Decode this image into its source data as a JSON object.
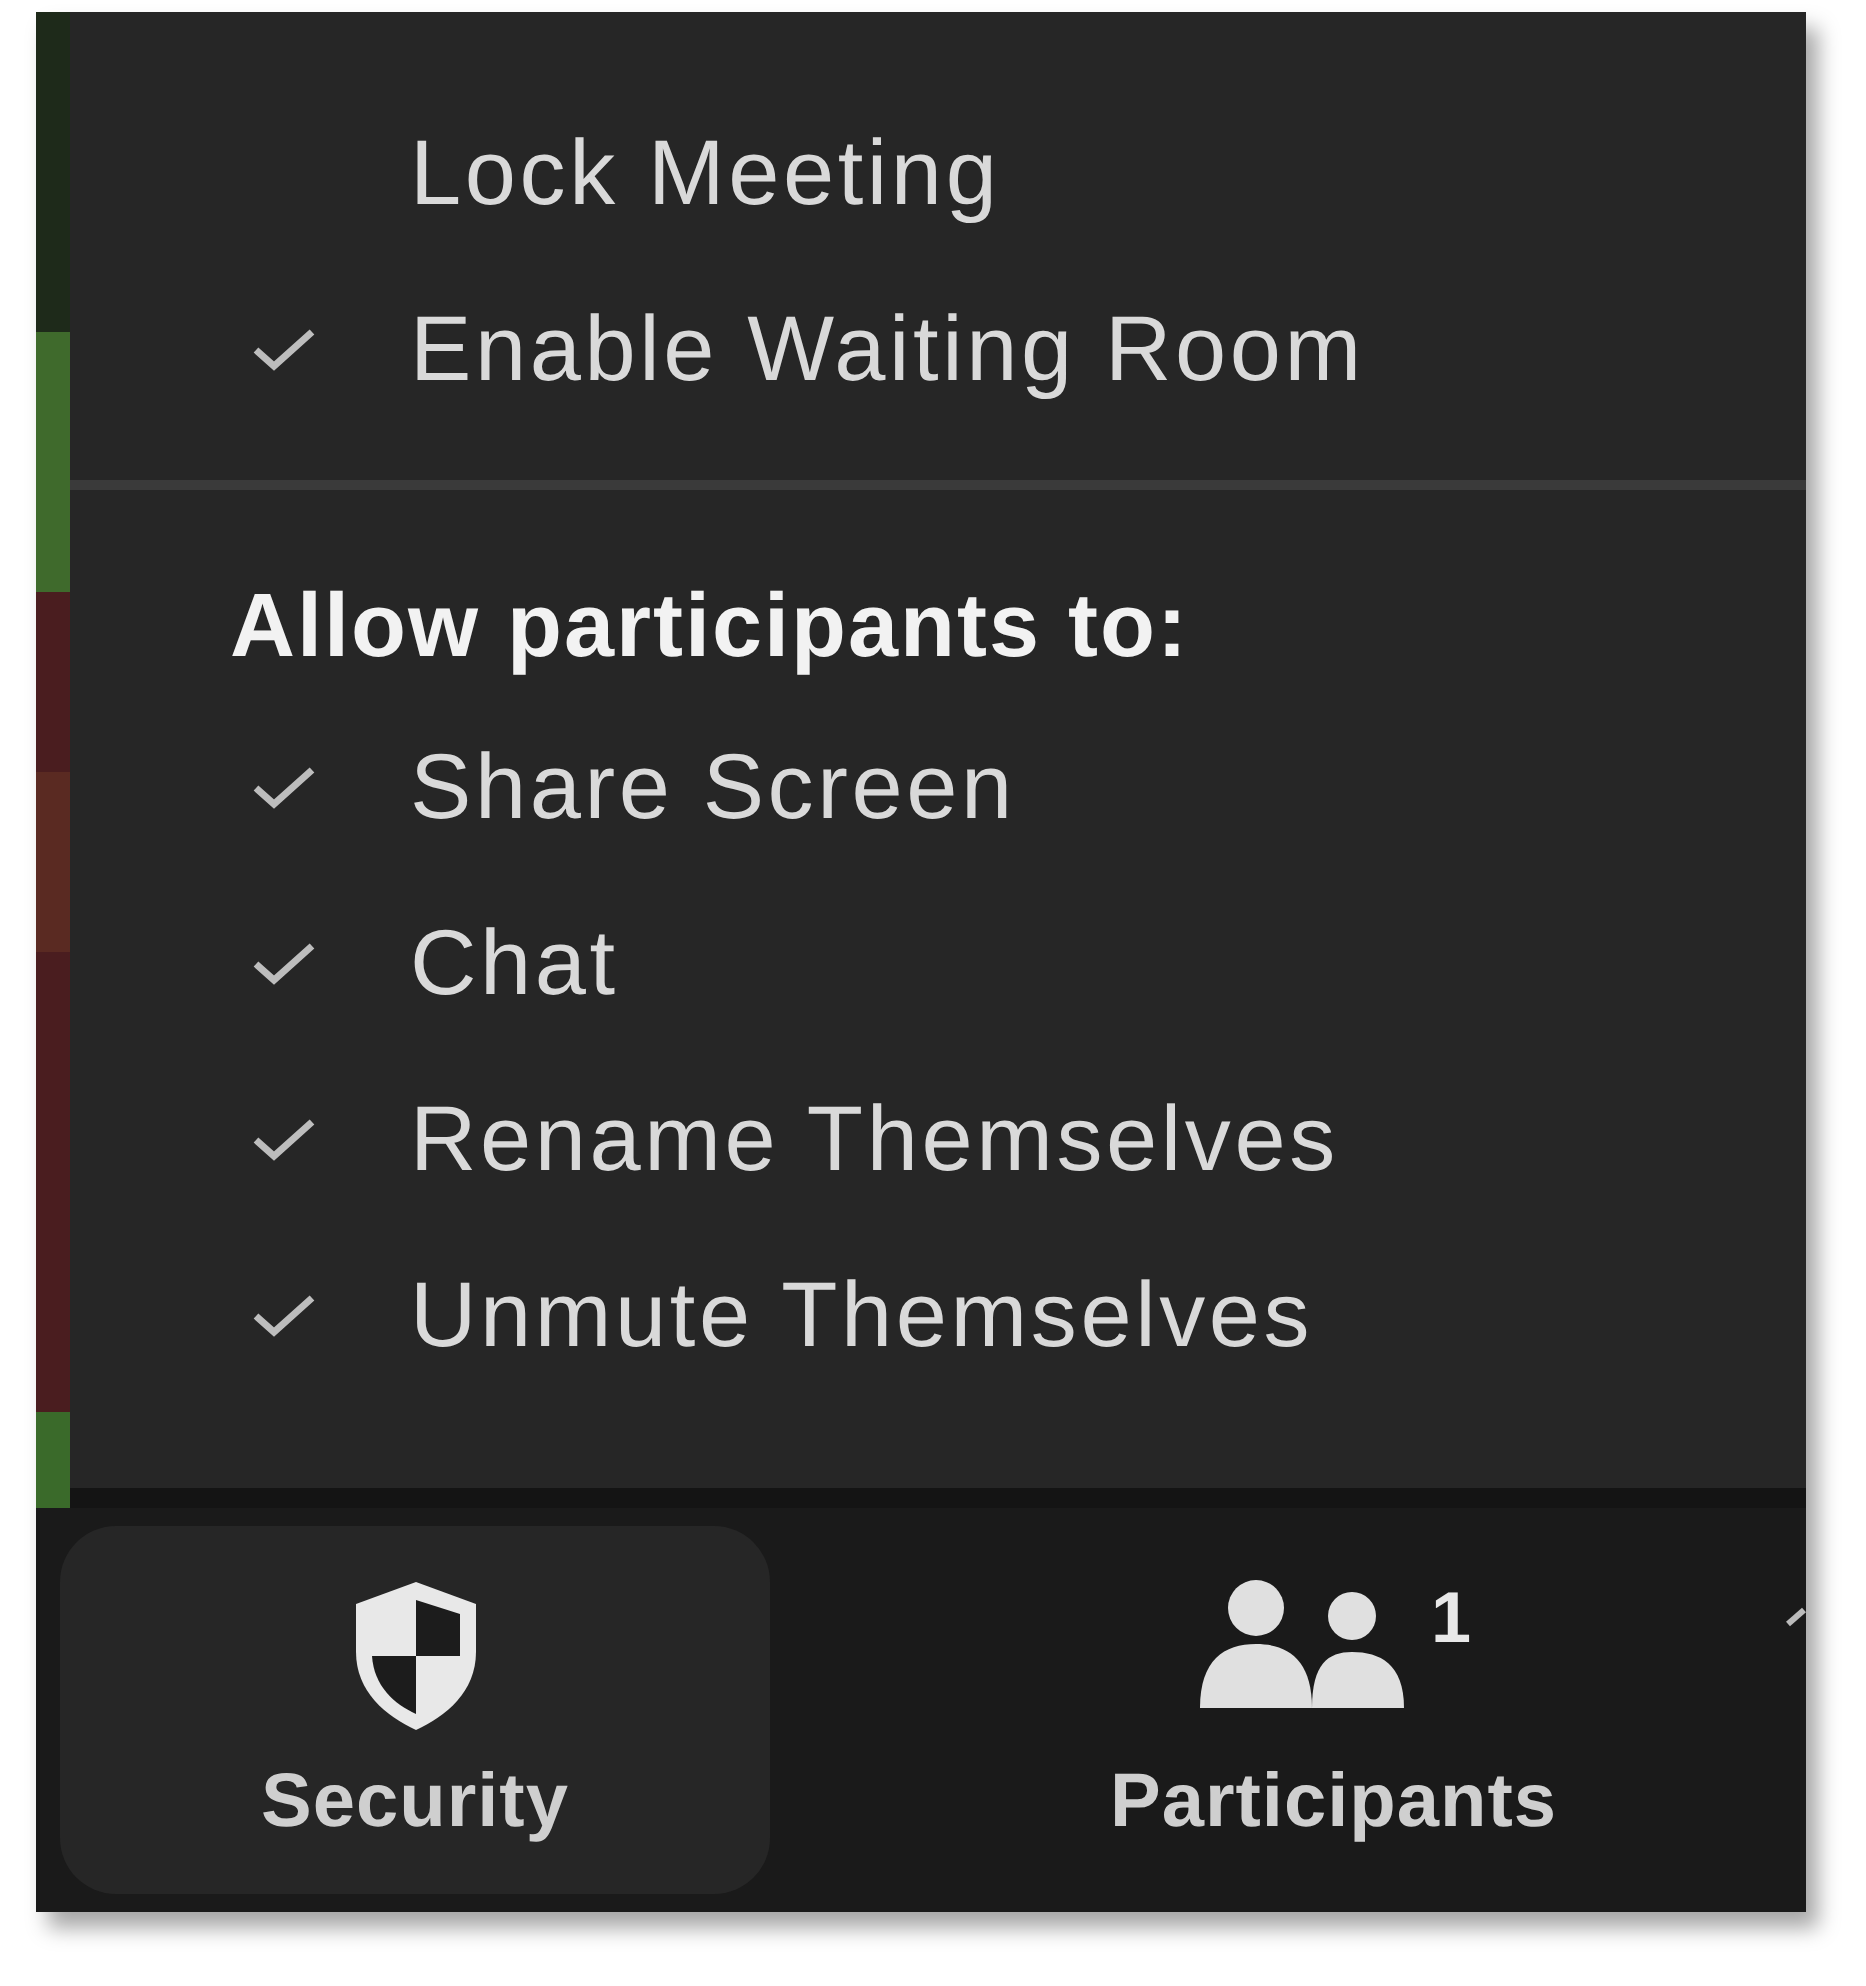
{
  "menu": {
    "items": [
      {
        "label": "Lock Meeting",
        "checked": false
      },
      {
        "label": "Enable Waiting Room",
        "checked": true
      }
    ],
    "section_header": "Allow participants to:",
    "permissions": [
      {
        "label": "Share Screen",
        "checked": true
      },
      {
        "label": "Chat",
        "checked": true
      },
      {
        "label": "Rename Themselves",
        "checked": true
      },
      {
        "label": "Unmute Themselves",
        "checked": true
      }
    ]
  },
  "toolbar": {
    "buttons": [
      {
        "kind": "security",
        "label": "Security",
        "selected": true
      },
      {
        "kind": "participants",
        "label": "Participants",
        "selected": false,
        "count": "1"
      }
    ]
  }
}
